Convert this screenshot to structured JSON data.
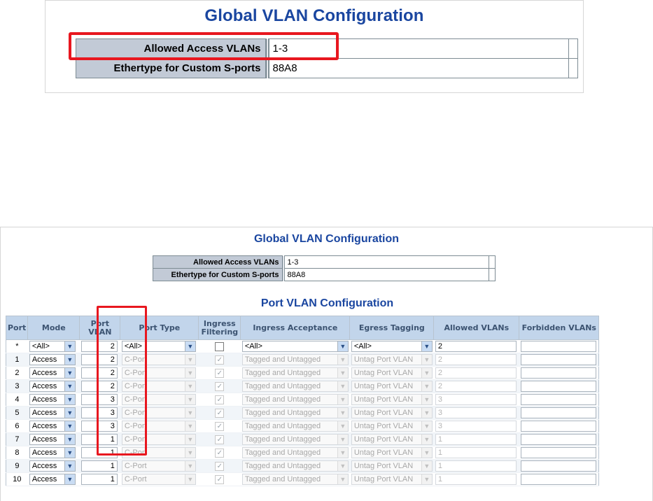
{
  "zoom_view": {
    "title": "Global VLAN Configuration",
    "rows": [
      {
        "label": "Allowed Access VLANs",
        "value": "1-3"
      },
      {
        "label": "Ethertype for Custom S-ports",
        "value": "88A8"
      }
    ]
  },
  "full_view": {
    "title": "Global VLAN Configuration",
    "global_rows": [
      {
        "label": "Allowed Access VLANs",
        "value": "1-3"
      },
      {
        "label": "Ethertype for Custom S-ports",
        "value": "88A8"
      }
    ],
    "port_title": "Port VLAN Configuration",
    "headers": {
      "port": "Port",
      "mode": "Mode",
      "port_vlan": "Port VLAN",
      "port_type": "Port Type",
      "ingress_filtering": "Ingress Filtering",
      "ingress_acceptance": "Ingress Acceptance",
      "egress_tagging": "Egress Tagging",
      "allowed_vlans": "Allowed VLANs",
      "forbidden_vlans": "Forbidden VLANs"
    },
    "rows": [
      {
        "port": "*",
        "mode": "<All>",
        "pvid": "2",
        "port_type": "<All>",
        "ingress_filtering": false,
        "acceptance": "<All>",
        "egress": "<All>",
        "allowed": "2",
        "forbidden": "",
        "disabled": false
      },
      {
        "port": "1",
        "mode": "Access",
        "pvid": "2",
        "port_type": "C-Port",
        "ingress_filtering": true,
        "acceptance": "Tagged and Untagged",
        "egress": "Untag Port VLAN",
        "allowed": "2",
        "forbidden": "",
        "disabled": true
      },
      {
        "port": "2",
        "mode": "Access",
        "pvid": "2",
        "port_type": "C-Port",
        "ingress_filtering": true,
        "acceptance": "Tagged and Untagged",
        "egress": "Untag Port VLAN",
        "allowed": "2",
        "forbidden": "",
        "disabled": true
      },
      {
        "port": "3",
        "mode": "Access",
        "pvid": "2",
        "port_type": "C-Port",
        "ingress_filtering": true,
        "acceptance": "Tagged and Untagged",
        "egress": "Untag Port VLAN",
        "allowed": "2",
        "forbidden": "",
        "disabled": true
      },
      {
        "port": "4",
        "mode": "Access",
        "pvid": "3",
        "port_type": "C-Port",
        "ingress_filtering": true,
        "acceptance": "Tagged and Untagged",
        "egress": "Untag Port VLAN",
        "allowed": "3",
        "forbidden": "",
        "disabled": true
      },
      {
        "port": "5",
        "mode": "Access",
        "pvid": "3",
        "port_type": "C-Port",
        "ingress_filtering": true,
        "acceptance": "Tagged and Untagged",
        "egress": "Untag Port VLAN",
        "allowed": "3",
        "forbidden": "",
        "disabled": true
      },
      {
        "port": "6",
        "mode": "Access",
        "pvid": "3",
        "port_type": "C-Port",
        "ingress_filtering": true,
        "acceptance": "Tagged and Untagged",
        "egress": "Untag Port VLAN",
        "allowed": "3",
        "forbidden": "",
        "disabled": true
      },
      {
        "port": "7",
        "mode": "Access",
        "pvid": "1",
        "port_type": "C-Port",
        "ingress_filtering": true,
        "acceptance": "Tagged and Untagged",
        "egress": "Untag Port VLAN",
        "allowed": "1",
        "forbidden": "",
        "disabled": true
      },
      {
        "port": "8",
        "mode": "Access",
        "pvid": "1",
        "port_type": "C-Port",
        "ingress_filtering": true,
        "acceptance": "Tagged and Untagged",
        "egress": "Untag Port VLAN",
        "allowed": "1",
        "forbidden": "",
        "disabled": true
      },
      {
        "port": "9",
        "mode": "Access",
        "pvid": "1",
        "port_type": "C-Port",
        "ingress_filtering": true,
        "acceptance": "Tagged and Untagged",
        "egress": "Untag Port VLAN",
        "allowed": "1",
        "forbidden": "",
        "disabled": true
      },
      {
        "port": "10",
        "mode": "Access",
        "pvid": "1",
        "port_type": "C-Port",
        "ingress_filtering": true,
        "acceptance": "Tagged and Untagged",
        "egress": "Untag Port VLAN",
        "allowed": "1",
        "forbidden": "",
        "disabled": true
      }
    ]
  },
  "icons": {
    "dropdown": "chevron-down-icon",
    "check": "checkmark-icon"
  },
  "colors": {
    "title": "#1a46a0",
    "header_bg": "#c2d5eb",
    "label_bg": "#c2cad6",
    "highlight": "#e8171f"
  }
}
